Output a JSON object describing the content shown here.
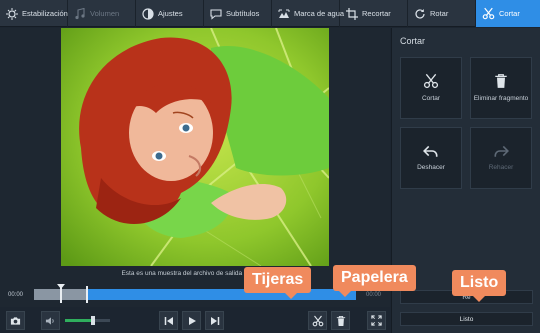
{
  "toolbar": {
    "items": [
      {
        "label": "Estabilización",
        "icon": "stabilization-icon",
        "state": "normal"
      },
      {
        "label": "Volumen",
        "icon": "music-note-icon",
        "state": "disabled"
      },
      {
        "label": "Ajustes",
        "icon": "contrast-icon",
        "state": "normal"
      },
      {
        "label": "Subtítulos",
        "icon": "speech-bubble-icon",
        "state": "normal"
      },
      {
        "label": "Marca de agua",
        "icon": "watermark-icon",
        "state": "normal"
      },
      {
        "label": "Recortar",
        "icon": "crop-icon",
        "state": "normal"
      },
      {
        "label": "Rotar",
        "icon": "rotate-icon",
        "state": "normal"
      },
      {
        "label": "Cortar",
        "icon": "scissors-icon",
        "state": "active"
      }
    ]
  },
  "preview": {
    "caption": "Esta es una muestra del archivo de salida después"
  },
  "panel": {
    "title": "Cortar",
    "buttons": [
      {
        "label": "Cortar",
        "icon": "scissors-icon",
        "enabled": true
      },
      {
        "label": "Eliminar fragmento",
        "icon": "trash-icon",
        "enabled": true
      },
      {
        "label": "Deshacer",
        "icon": "undo-icon",
        "enabled": true
      },
      {
        "label": "Rehacer",
        "icon": "redo-icon",
        "enabled": false
      }
    ],
    "reset_label": "Re",
    "done_label": "Listo"
  },
  "timeline": {
    "start_time": "00:00",
    "end_time": "00:00",
    "selected_fraction": 0.16,
    "playhead_fraction": 0.08
  },
  "controls": {
    "volume_fraction": 0.62
  },
  "callouts": {
    "scissors": "Tijeras",
    "trash": "Papelera",
    "done": "Listo"
  },
  "colors": {
    "accent": "#2f8ee6",
    "callout": "#f08a5d",
    "volume": "#2fae5d"
  }
}
